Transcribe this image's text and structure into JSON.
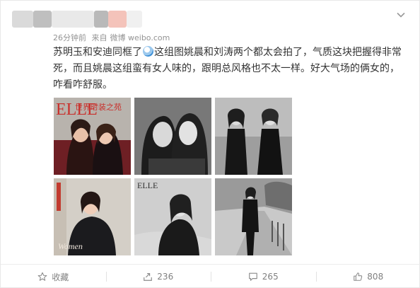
{
  "meta": {
    "time_ago": "26分钟前",
    "source_prefix": "来自",
    "source_name": "微博 weibo.com"
  },
  "post": {
    "line1_a": "苏明玉和安迪同框了",
    "line1_b": "这组图姚晨和刘涛两个都太会拍了，气质这块把握得非常",
    "line2": "死，而且姚晨这组蛮有女人味的，跟明总风格也不太一样。好大气场的俩女的，",
    "line3": "咋看咋舒服。"
  },
  "photos": {
    "magazine_title": "ELLE",
    "magazine_subtitle": "世界时装之苑"
  },
  "actions": {
    "favorite_label": "收藏",
    "repost_count": "236",
    "comment_count": "265",
    "like_count": "808"
  },
  "colors": {
    "text": "#333333",
    "meta": "#939393",
    "action": "#808080"
  },
  "icons": {
    "more": "chevron-down-icon",
    "favorite": "star-icon",
    "repost": "repost-icon",
    "comment": "comment-icon",
    "like": "thumbs-up-icon",
    "emoji": "emoji-icon"
  }
}
